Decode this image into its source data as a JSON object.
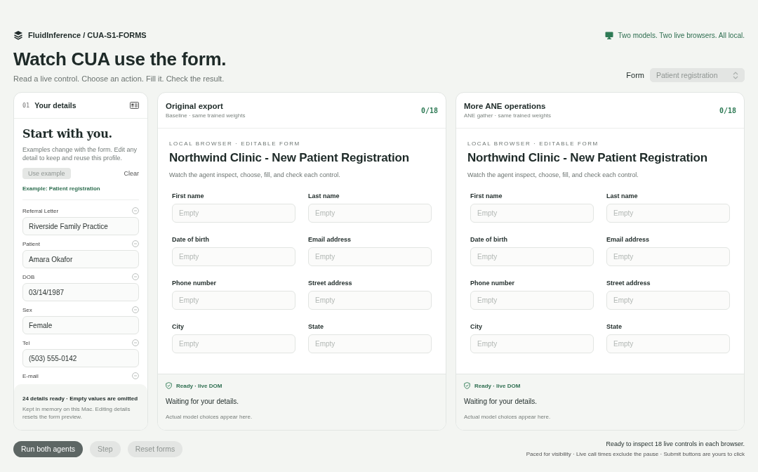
{
  "header": {
    "brand": "FluidInference / CUA-S1-FORMS",
    "tagline": "Two models. Two live browsers. All local.",
    "title": "Watch CUA use the form.",
    "subtitle": "Read a live control. Choose an action. Fill it. Check the result.",
    "form_select": {
      "label": "Form",
      "value": "Patient registration",
      "disabled": true
    }
  },
  "details": {
    "step": "01",
    "title": "Your details",
    "heading": "Start with you.",
    "description": "Examples change with the form. Edit any detail to keep and reuse this profile.",
    "use_example": {
      "label": "Use example",
      "disabled": true
    },
    "clear": "Clear",
    "example_note": "Example: Patient registration",
    "fields": [
      {
        "label": "Referral Letter",
        "value": "Riverside Family Practice"
      },
      {
        "label": "Patient",
        "value": "Amara Okafor"
      },
      {
        "label": "DOB",
        "value": "03/14/1987"
      },
      {
        "label": "Sex",
        "value": "Female"
      },
      {
        "label": "Tel",
        "value": "(503) 555-0142"
      },
      {
        "label": "E-mail"
      }
    ],
    "footer_title": "24 details ready · Empty values are omitted",
    "footer_note": "Kept in memory on this Mac. Editing details resets the form preview."
  },
  "agents": [
    {
      "name": "Original export",
      "subtitle": "Baseline · same trained weights",
      "progress": "0/18",
      "eyebrow": "LOCAL BROWSER · EDITABLE FORM",
      "form_title": "Northwind Clinic - New Patient Registration",
      "form_intro": "Watch the agent inspect, choose, fill, and check each control.",
      "fields": [
        {
          "label": "First name",
          "placeholder": "Empty"
        },
        {
          "label": "Last name",
          "placeholder": "Empty"
        },
        {
          "label": "Date of birth",
          "placeholder": "Empty"
        },
        {
          "label": "Email address",
          "placeholder": "Empty"
        },
        {
          "label": "Phone number",
          "placeholder": "Empty"
        },
        {
          "label": "Street address",
          "placeholder": "Empty"
        },
        {
          "label": "City",
          "placeholder": "Empty"
        },
        {
          "label": "State",
          "placeholder": "Empty"
        }
      ],
      "status": "Ready · live DOM",
      "message": "Waiting for your details.",
      "note": "Actual model choices appear here."
    },
    {
      "name": "More ANE operations",
      "subtitle": "ANE gather · same trained weights",
      "progress": "0/18",
      "eyebrow": "LOCAL BROWSER · EDITABLE FORM",
      "form_title": "Northwind Clinic - New Patient Registration",
      "form_intro": "Watch the agent inspect, choose, fill, and check each control.",
      "fields": [
        {
          "label": "First name",
          "placeholder": "Empty"
        },
        {
          "label": "Last name",
          "placeholder": "Empty"
        },
        {
          "label": "Date of birth",
          "placeholder": "Empty"
        },
        {
          "label": "Email address",
          "placeholder": "Empty"
        },
        {
          "label": "Phone number",
          "placeholder": "Empty"
        },
        {
          "label": "Street address",
          "placeholder": "Empty"
        },
        {
          "label": "City",
          "placeholder": "Empty"
        },
        {
          "label": "State",
          "placeholder": "Empty"
        }
      ],
      "status": "Ready · live DOM",
      "message": "Waiting for your details.",
      "note": "Actual model choices appear here."
    }
  ],
  "actions": [
    {
      "label": "Run both agents",
      "disabled": false
    },
    {
      "label": "Step",
      "disabled": true
    },
    {
      "label": "Reset forms",
      "disabled": true
    }
  ],
  "footer": {
    "status": "Ready to inspect 18 live controls in each browser.",
    "note": "Paced for visibility · Live call times exclude the pause · Submit buttons are yours to click"
  }
}
